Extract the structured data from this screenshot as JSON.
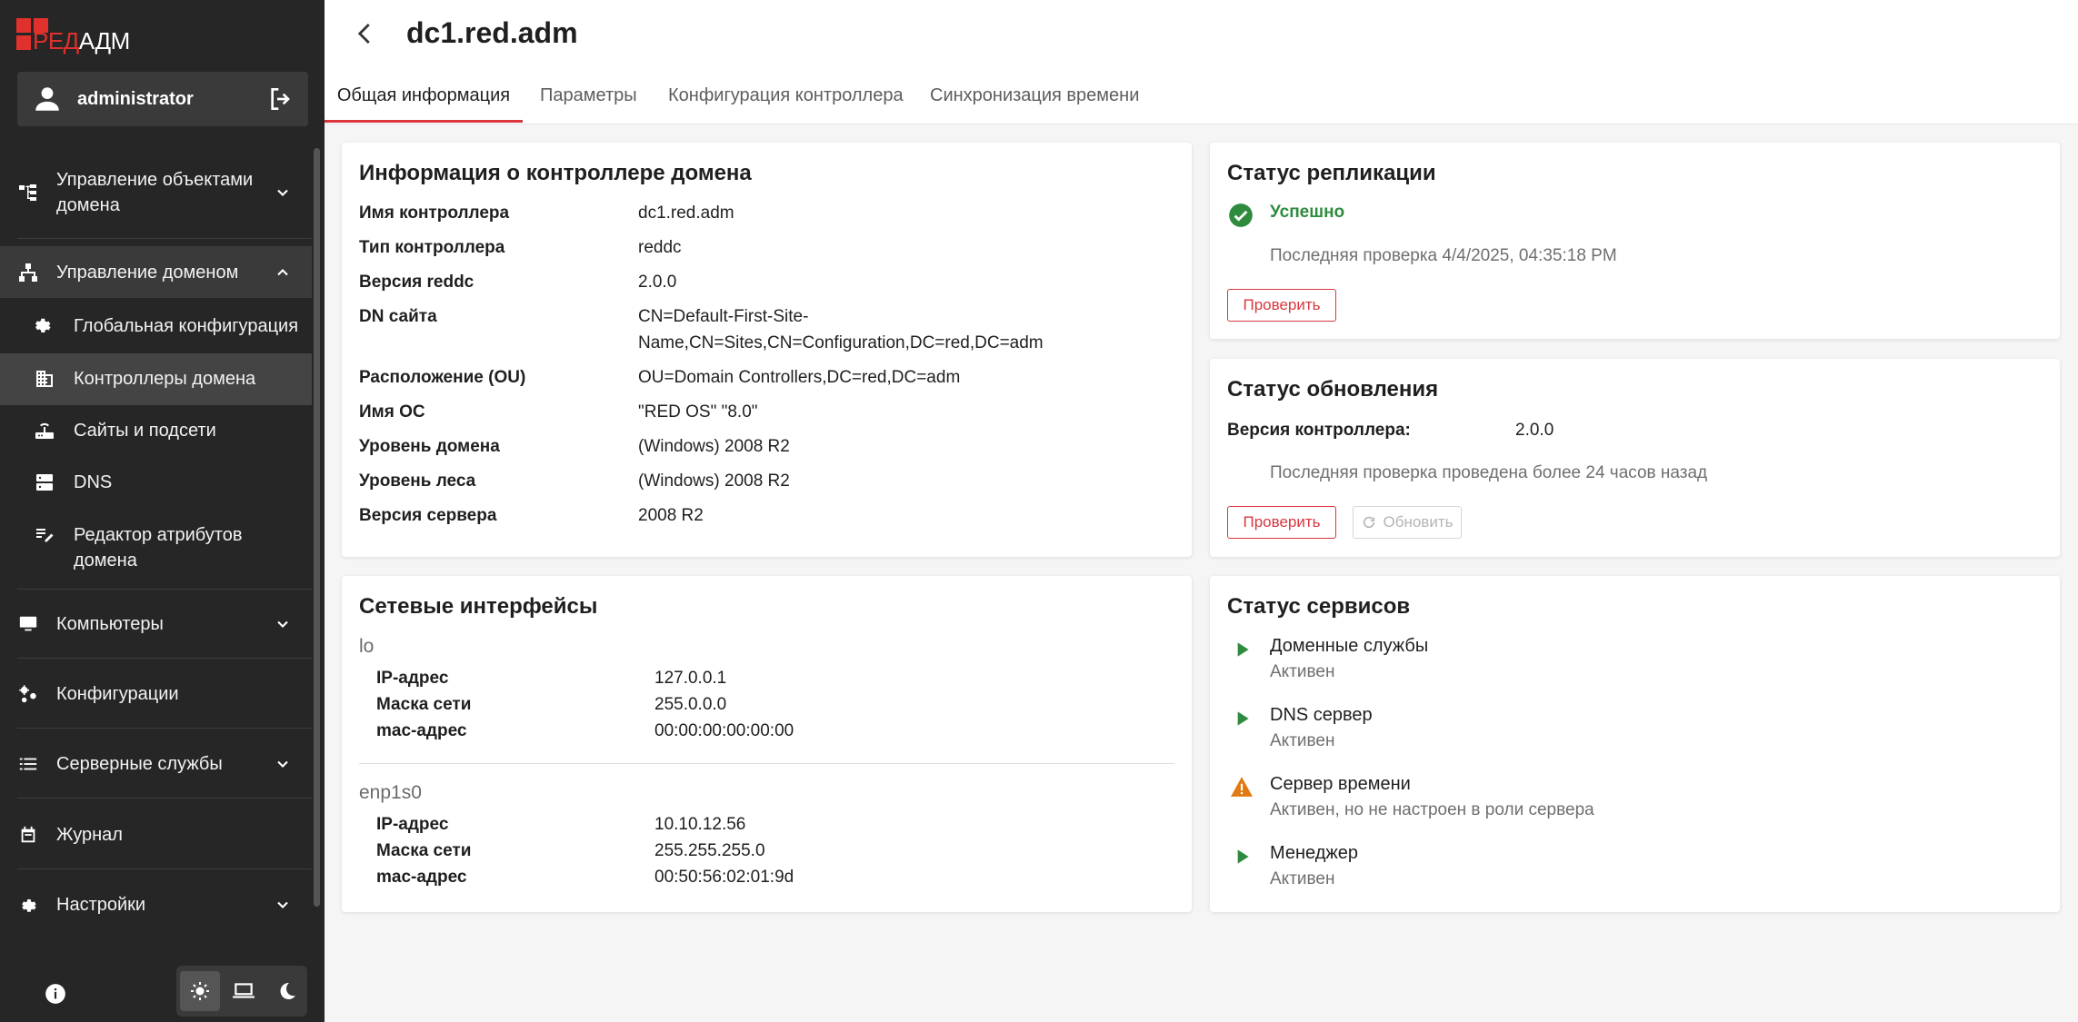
{
  "app": {
    "logo": {
      "red_part": "РЕД",
      "white_part": "АДМ"
    },
    "user": {
      "name": "administrator"
    }
  },
  "sidebar": {
    "sections": [
      {
        "label": "Управление объектами домена",
        "icon": "tree-structure-icon",
        "expanded": false
      },
      {
        "label": "Управление доменом",
        "icon": "hierarchy-icon",
        "expanded": true,
        "items": [
          {
            "label": "Глобальная конфигурация",
            "icon": "gear-settings-icon"
          },
          {
            "label": "Контроллеры домена",
            "icon": "building-icon",
            "active": true
          },
          {
            "label": "Сайты и подсети",
            "icon": "router-icon"
          },
          {
            "label": "DNS",
            "icon": "server-icon"
          },
          {
            "label": "Редактор атрибутов домена",
            "icon": "edit-list-icon"
          }
        ]
      },
      {
        "label": "Компьютеры",
        "icon": "monitor-icon",
        "expanded": false
      },
      {
        "label": "Конфигурации",
        "icon": "config-icon"
      },
      {
        "label": "Серверные службы",
        "icon": "list-icon",
        "expanded": false
      },
      {
        "label": "Журнал",
        "icon": "calendar-icon"
      },
      {
        "label": "Настройки",
        "icon": "gear-icon",
        "expanded": false
      }
    ],
    "theme": {
      "selected": "light",
      "options": [
        "light",
        "system",
        "dark"
      ]
    }
  },
  "header": {
    "title": "dc1.red.adm"
  },
  "tabs": [
    {
      "label": "Общая информация",
      "active": true
    },
    {
      "label": "Параметры",
      "active": false
    },
    {
      "label": "Конфигурация контроллера",
      "active": false
    },
    {
      "label": "Синхронизация времени",
      "active": false
    }
  ],
  "controller_info": {
    "title": "Информация о контроллере домена",
    "rows": [
      {
        "key": "Имя контроллера",
        "value": "dc1.red.adm"
      },
      {
        "key": "Тип контроллера",
        "value": "reddc"
      },
      {
        "key": "Версия reddc",
        "value": "2.0.0"
      },
      {
        "key": "DN сайта",
        "value_line1": "CN=Default-First-Site-",
        "value_line2": "Name,CN=Sites,CN=Configuration,DC=red,DC=adm"
      },
      {
        "key": "Расположение (OU)",
        "value": "OU=Domain Controllers,DC=red,DC=adm"
      },
      {
        "key": "Имя ОС",
        "value": "\"RED OS\" \"8.0\""
      },
      {
        "key": "Уровень домена",
        "value": "(Windows) 2008 R2"
      },
      {
        "key": "Уровень леса",
        "value": "(Windows) 2008 R2"
      },
      {
        "key": "Версия сервера",
        "value": "2008 R2"
      }
    ]
  },
  "network": {
    "title": "Сетевые интерфейсы",
    "interfaces": [
      {
        "name": "lo",
        "rows": [
          {
            "key": "IP-адрес",
            "value": "127.0.0.1"
          },
          {
            "key": "Маска сети",
            "value": "255.0.0.0"
          },
          {
            "key": "mac-адрес",
            "value": "00:00:00:00:00:00"
          }
        ]
      },
      {
        "name": "enp1s0",
        "rows": [
          {
            "key": "IP-адрес",
            "value": "10.10.12.56"
          },
          {
            "key": "Маска сети",
            "value": "255.255.255.0"
          },
          {
            "key": "mac-адрес",
            "value": "00:50:56:02:01:9d"
          }
        ]
      }
    ]
  },
  "replication": {
    "title": "Статус репликации",
    "status": "Успешно",
    "last_check": "Последняя проверка 4/4/2025, 04:35:18 PM",
    "check_button": "Проверить",
    "colors": {
      "success": "#2e8b3e"
    }
  },
  "update": {
    "title": "Статус обновления",
    "version_label": "Версия контроллера:",
    "version_value": "2.0.0",
    "last_check": "Последняя проверка проведена более 24 часов назад",
    "check_button": "Проверить",
    "update_button": "Обновить"
  },
  "services": {
    "title": "Статус сервисов",
    "items": [
      {
        "name": "Доменные службы",
        "state": "Активен",
        "icon": "play-icon"
      },
      {
        "name": "DNS сервер",
        "state": "Активен",
        "icon": "play-icon"
      },
      {
        "name": "Сервер времени",
        "state": "Активен, но не настроен в роли сервера",
        "icon": "warning-icon"
      },
      {
        "name": "Менеджер",
        "state": "Активен",
        "icon": "play-icon"
      }
    ],
    "colors": {
      "ok": "#2e8b3e",
      "warning": "#e07a12"
    }
  },
  "colors": {
    "accent": "#d9363e",
    "sidebar_bg": "#262626"
  }
}
